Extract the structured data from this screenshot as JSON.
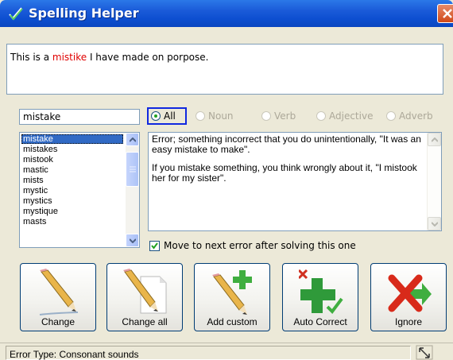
{
  "window": {
    "title": "Spelling Helper",
    "app_icon": "check-pen-icon",
    "close_icon": "close-icon"
  },
  "sentence": {
    "before": "This is a ",
    "mistake": "mistike",
    "after": " I have made on porpose."
  },
  "word_input": {
    "value": "mistake"
  },
  "suggestions": {
    "items": [
      "mistake",
      "mistakes",
      "mistook",
      "mastic",
      "mists",
      "mystic",
      "mystics",
      "mystique",
      "masts"
    ],
    "selected_index": 0
  },
  "word_types": {
    "options": [
      {
        "label": "All",
        "checked": true,
        "enabled": true
      },
      {
        "label": "Noun",
        "checked": false,
        "enabled": false
      },
      {
        "label": "Verb",
        "checked": false,
        "enabled": false
      },
      {
        "label": "Adjective",
        "checked": false,
        "enabled": false
      },
      {
        "label": "Adverb",
        "checked": false,
        "enabled": false
      }
    ]
  },
  "definition": {
    "paragraphs": [
      "Error; something incorrect that you do unintentionally, \"It was an easy mistake to make\".",
      "If you mistake something, you think wrongly about it, \"I mistook her for my sister\"."
    ]
  },
  "move_next": {
    "label": "Move to next error after solving this one",
    "checked": true
  },
  "buttons": [
    {
      "label": "Change",
      "icon": "pencil-icon"
    },
    {
      "label": "Change all",
      "icon": "pencil-document-icon"
    },
    {
      "label": "Add custom",
      "icon": "pencil-plus-icon"
    },
    {
      "label": "Auto Correct",
      "icon": "plus-check-icon"
    },
    {
      "label": "Ignore",
      "icon": "red-x-arrow-icon"
    }
  ],
  "status": {
    "text": "Error Type: Consonant sounds",
    "grip_icon": "resize-grip-icon"
  },
  "colors": {
    "titlebar": "#0a46c0",
    "mistake": "#e00000",
    "selection": "#316ac5",
    "focus": "#1028e0"
  }
}
